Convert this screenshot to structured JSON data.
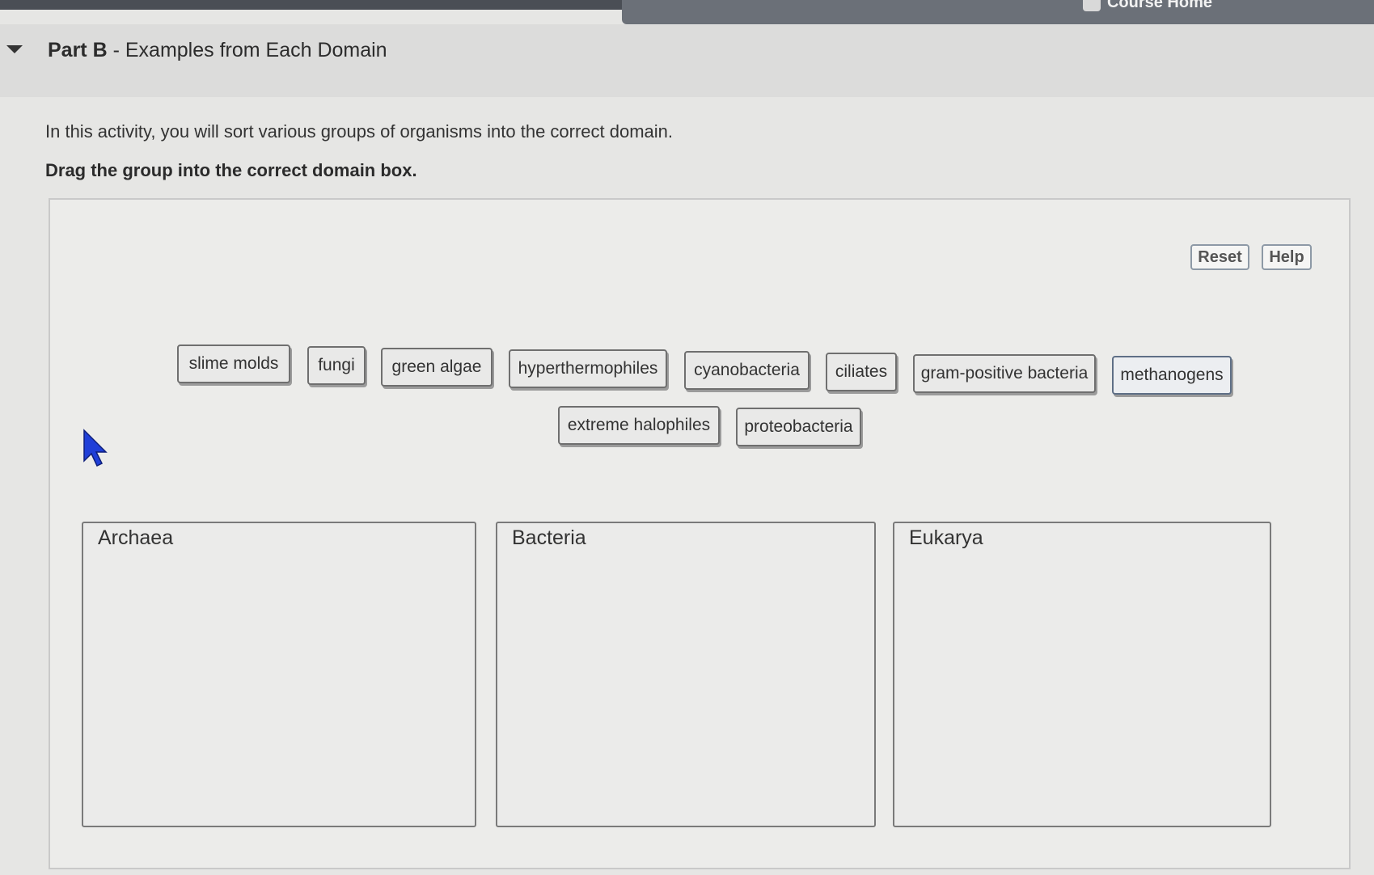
{
  "topbar": {
    "course_home": "Course Home"
  },
  "header": {
    "part_label": "Part B",
    "separator": " - ",
    "title": "Examples from Each Domain"
  },
  "content": {
    "intro": "In this activity, you will sort various groups of organisms into the correct domain.",
    "instruction": "Drag the group into the correct domain box."
  },
  "toolbar": {
    "reset": "Reset",
    "help": "Help"
  },
  "chips": [
    "slime molds",
    "fungi",
    "green algae",
    "hyperthermophiles",
    "cyanobacteria",
    "ciliates",
    "gram-positive bacteria",
    "methanogens",
    "extreme halophiles",
    "proteobacteria"
  ],
  "domains": [
    "Archaea",
    "Bacteria",
    "Eukarya"
  ],
  "colors": {
    "accent_border": "#5f6f86",
    "cursor": "#1f3fd8"
  }
}
